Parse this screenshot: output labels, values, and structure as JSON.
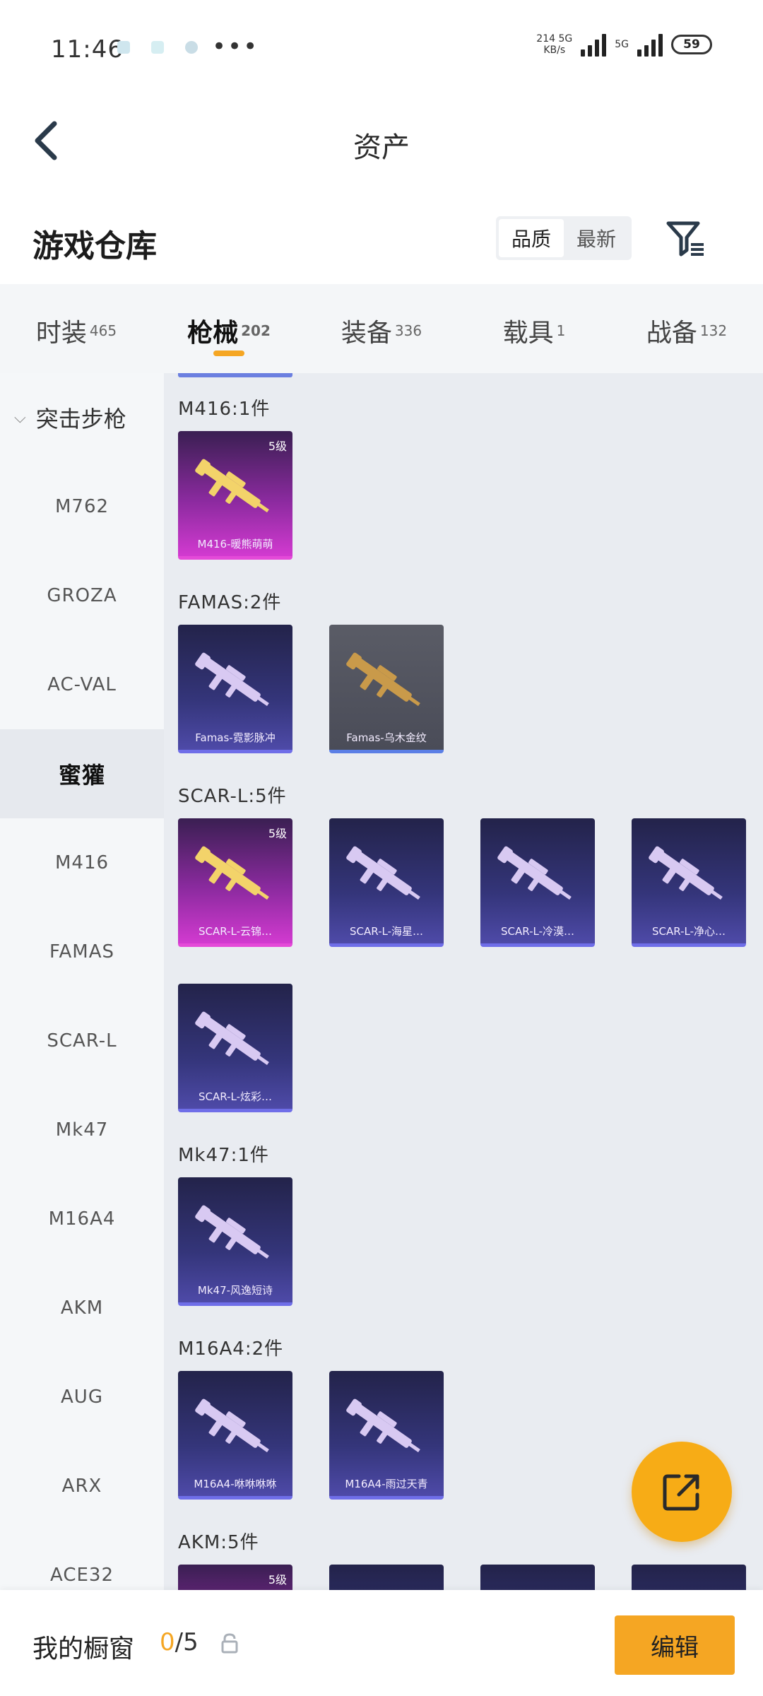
{
  "status_bar": {
    "time": "11:46",
    "speed_value": "214",
    "speed_unit": "KB/s",
    "net_type_1": "5G",
    "net_type_2": "5G",
    "battery": "59"
  },
  "header": {
    "title": "资产"
  },
  "warehouse": {
    "title": "游戏仓库",
    "sort_options": [
      "品质",
      "最新"
    ],
    "active_sort": "品质"
  },
  "tabs": [
    {
      "label": "时装",
      "count": "465"
    },
    {
      "label": "枪械",
      "count": "202",
      "active": true
    },
    {
      "label": "装备",
      "count": "336"
    },
    {
      "label": "载具",
      "count": "1"
    },
    {
      "label": "战备",
      "count": "132"
    }
  ],
  "sidebar": {
    "group": "突击步枪",
    "items": [
      "M762",
      "GROZA",
      "AC-VAL",
      "蜜獾",
      "M416",
      "FAMAS",
      "SCAR-L",
      "Mk47",
      "M16A4",
      "AKM",
      "AUG",
      "ARX",
      "ACE32"
    ],
    "active_item": "蜜獾"
  },
  "sections": [
    {
      "label": "M416:1件",
      "items": [
        {
          "name": "M416-暖熊萌萌",
          "tier": "5级",
          "rarity": "pink"
        }
      ]
    },
    {
      "label": "FAMAS:2件",
      "items": [
        {
          "name": "Famas-霓影脉冲",
          "rarity": "purple"
        },
        {
          "name": "Famas-乌木金纹",
          "rarity": "grey"
        }
      ]
    },
    {
      "label": "SCAR-L:5件",
      "items": [
        {
          "name": "SCAR-L-云锦…",
          "tier": "5级",
          "rarity": "pink"
        },
        {
          "name": "SCAR-L-海星…",
          "rarity": "purple"
        },
        {
          "name": "SCAR-L-冷漠…",
          "rarity": "purple"
        },
        {
          "name": "SCAR-L-净心…",
          "rarity": "purple"
        },
        {
          "name": "SCAR-L-炫彩…",
          "rarity": "purple"
        }
      ]
    },
    {
      "label": "Mk47:1件",
      "items": [
        {
          "name": "Mk47-风逸短诗",
          "rarity": "purple"
        }
      ]
    },
    {
      "label": "M16A4:2件",
      "items": [
        {
          "name": "M16A4-咻咻咻咻",
          "rarity": "purple"
        },
        {
          "name": "M16A4-雨过天青",
          "rarity": "purple"
        }
      ]
    },
    {
      "label": "AKM:5件",
      "items": [
        {
          "tier": "5级",
          "rarity": "pink"
        },
        {
          "rarity": "purple"
        },
        {
          "rarity": "purple"
        },
        {
          "rarity": "purple"
        }
      ]
    }
  ],
  "bottom_bar": {
    "showcase_label": "我的橱窗",
    "showcase_current": "0",
    "showcase_total": "/5",
    "edit_label": "编辑"
  },
  "icons": {
    "back": "back-arrow-icon",
    "filter": "filter-icon",
    "share": "share-icon",
    "lock": "lock-icon"
  },
  "colors": {
    "accent": "#f5a623",
    "pink_rarity": "#e44ad8",
    "purple_rarity": "#6f6ee8"
  }
}
